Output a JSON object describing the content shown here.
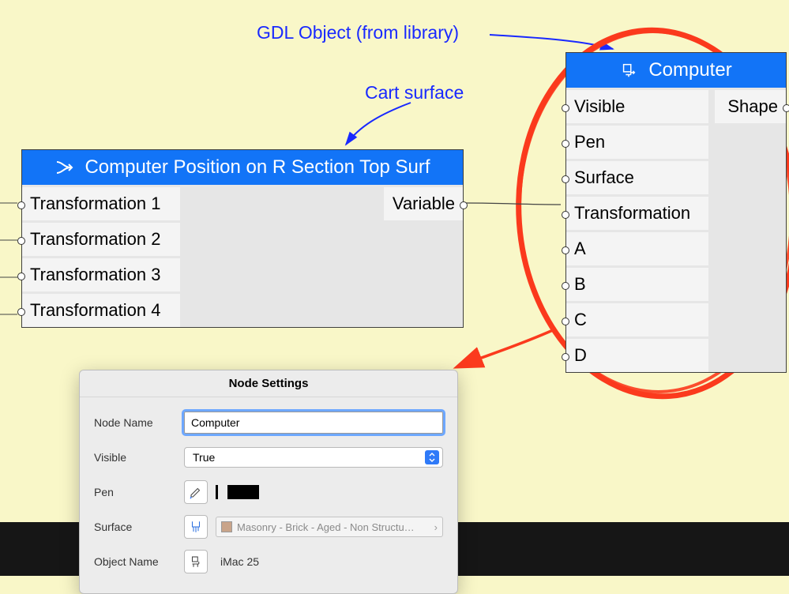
{
  "annotations": {
    "gdl_label": "GDL Object (from library)",
    "cart_label": "Cart  surface"
  },
  "node_left": {
    "title": "Computer Position on R Section Top Surf",
    "inputs": [
      "Transformation 1",
      "Transformation 2",
      "Transformation 3",
      "Transformation 4"
    ],
    "outputs": [
      "Variable"
    ]
  },
  "node_right": {
    "title": "Computer",
    "inputs": [
      "Visible",
      "Pen",
      "Surface",
      "Transformation",
      "A",
      "B",
      "C",
      "D"
    ],
    "outputs": [
      "Shape"
    ]
  },
  "dialog": {
    "title": "Node Settings",
    "rows": {
      "node_name": {
        "label": "Node Name",
        "value": "Computer"
      },
      "visible": {
        "label": "Visible",
        "value": "True"
      },
      "pen": {
        "label": "Pen"
      },
      "surface": {
        "label": "Surface",
        "value": "Masonry - Brick - Aged - Non Structu…"
      },
      "object": {
        "label": "Object Name",
        "value": "iMac 25"
      }
    }
  },
  "colors": {
    "accent": "#1274f7",
    "anno": "#1929ff",
    "highlight": "#fb3a1d"
  }
}
